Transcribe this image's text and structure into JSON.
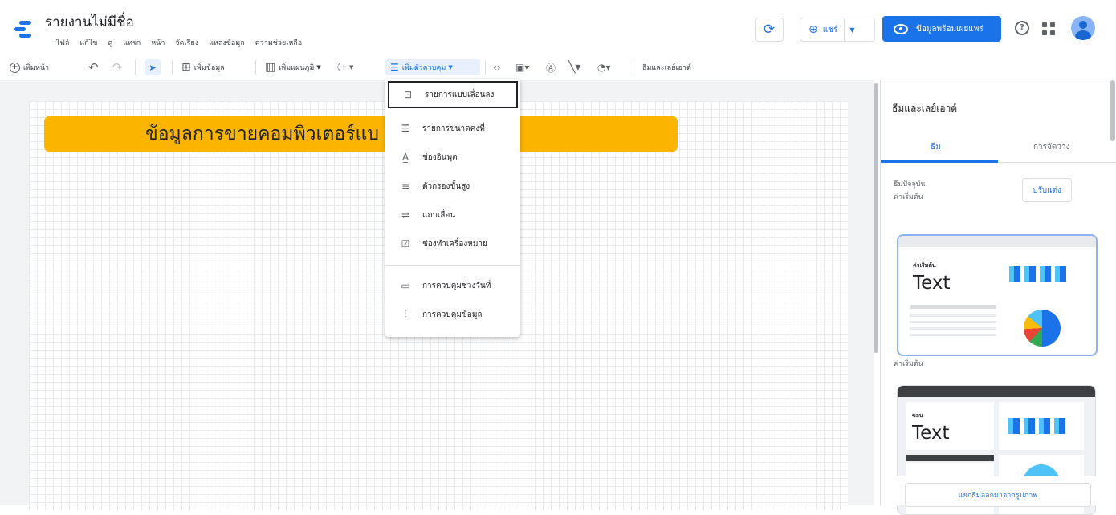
{
  "header": {
    "title": "รายงานไม่มีชื่อ",
    "menus": [
      "ไฟล์",
      "แก้ไข",
      "ดู",
      "แทรก",
      "หน้า",
      "จัดเรียง",
      "แหล่งข้อมูล",
      "ความช่วยเหลือ"
    ],
    "share_label": "แชร์",
    "view_label": "ข้อมูลพร้อมเผยแพร่"
  },
  "toolbar": {
    "add_page": "เพิ่มหน้า",
    "add_data": "เพิ่มข้อมูล",
    "add_chart": "เพิ่มแผนภูมิ",
    "add_control": "เพิ่มตัวควบคุม",
    "theme_layout": "ธีมและเลย์เอาต์"
  },
  "canvas": {
    "banner_text": "ข้อมูลการขายคอมพิวเตอร์แบ                     7-2018",
    "banner_color": "#fbb400"
  },
  "control_menu": {
    "items": [
      {
        "label": "รายการแบบเลื่อนลง",
        "icon": "dropdown-list-icon"
      },
      {
        "label": "รายการขนาดคงที่",
        "icon": "list-icon"
      },
      {
        "label": "ช่องอินพุต",
        "icon": "input-box-icon"
      },
      {
        "label": "ตัวกรองขั้นสูง",
        "icon": "advanced-filter-icon"
      },
      {
        "label": "แถบเลื่อน",
        "icon": "slider-icon"
      },
      {
        "label": "ช่องทำเครื่องหมาย",
        "icon": "checkbox-icon"
      },
      {
        "label": "การควบคุมช่วงวันที่",
        "icon": "calendar-icon"
      },
      {
        "label": "การควบคุมข้อมูล",
        "icon": "data-control-icon"
      }
    ]
  },
  "panel": {
    "title": "ธีมและเลย์เอาต์",
    "tabs": [
      "ธีม",
      "การจัดวาง"
    ],
    "current_theme_label": "ธีมปัจจุบัน",
    "current_theme_value": "ค่าเริ่มต้น",
    "customize_button": "ปรับแต่ง",
    "themes": [
      {
        "small_label": "ค่าเริ่มต้น",
        "sample_text": "Text",
        "caption": "ค่าเริ่มต้น"
      },
      {
        "small_label": "ขอบ",
        "sample_text": "Text"
      }
    ],
    "extract_button": "แยกธีมออกมาจากรูปภาพ"
  },
  "colors": {
    "accent": "#1a73e8",
    "banner": "#fbb400"
  }
}
